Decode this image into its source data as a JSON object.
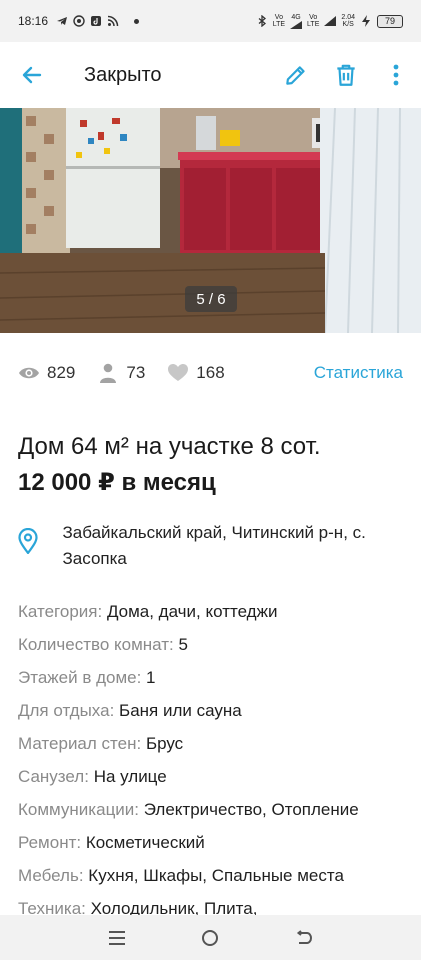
{
  "status_bar": {
    "time": "18:16",
    "net1": "Vo",
    "net1b": "LTE",
    "net2": "4G",
    "net3": "Vo",
    "net3b": "LTE",
    "speed": "2.04",
    "speed_unit": "K/S",
    "battery": "79"
  },
  "appbar": {
    "title": "Закрыто",
    "icons": [
      "back-arrow-icon",
      "edit-icon",
      "delete-icon",
      "more-icon"
    ],
    "accent": "#2aa5d8"
  },
  "gallery": {
    "counter": "5 / 6"
  },
  "stats": {
    "views": "829",
    "contacts": "73",
    "favorites": "168",
    "link": "Статистика"
  },
  "listing": {
    "title": "Дом 64 м² на участке 8 сот.",
    "price": "12 000 ₽ в месяц",
    "address": "Забайкальский край, Читинский р-н, с. Засопка"
  },
  "properties": [
    {
      "key": "Категория:",
      "value": "Дома, дачи, коттеджи"
    },
    {
      "key": "Количество комнат:",
      "value": "5"
    },
    {
      "key": "Этажей в доме:",
      "value": "1"
    },
    {
      "key": "Для отдыха:",
      "value": "Баня или сауна"
    },
    {
      "key": "Материал стен:",
      "value": "Брус"
    },
    {
      "key": "Санузел:",
      "value": "На улице"
    },
    {
      "key": "Коммуникации:",
      "value": "Электричество, Отопление"
    },
    {
      "key": "Ремонт:",
      "value": "Косметический"
    },
    {
      "key": "Мебель:",
      "value": "Кухня, Шкафы, Спальные места"
    },
    {
      "key": "Техника:",
      "value": "Холодильник, Плита,"
    }
  ],
  "navbar": {
    "icons": [
      "recent-apps-icon",
      "home-icon",
      "back-icon"
    ]
  }
}
